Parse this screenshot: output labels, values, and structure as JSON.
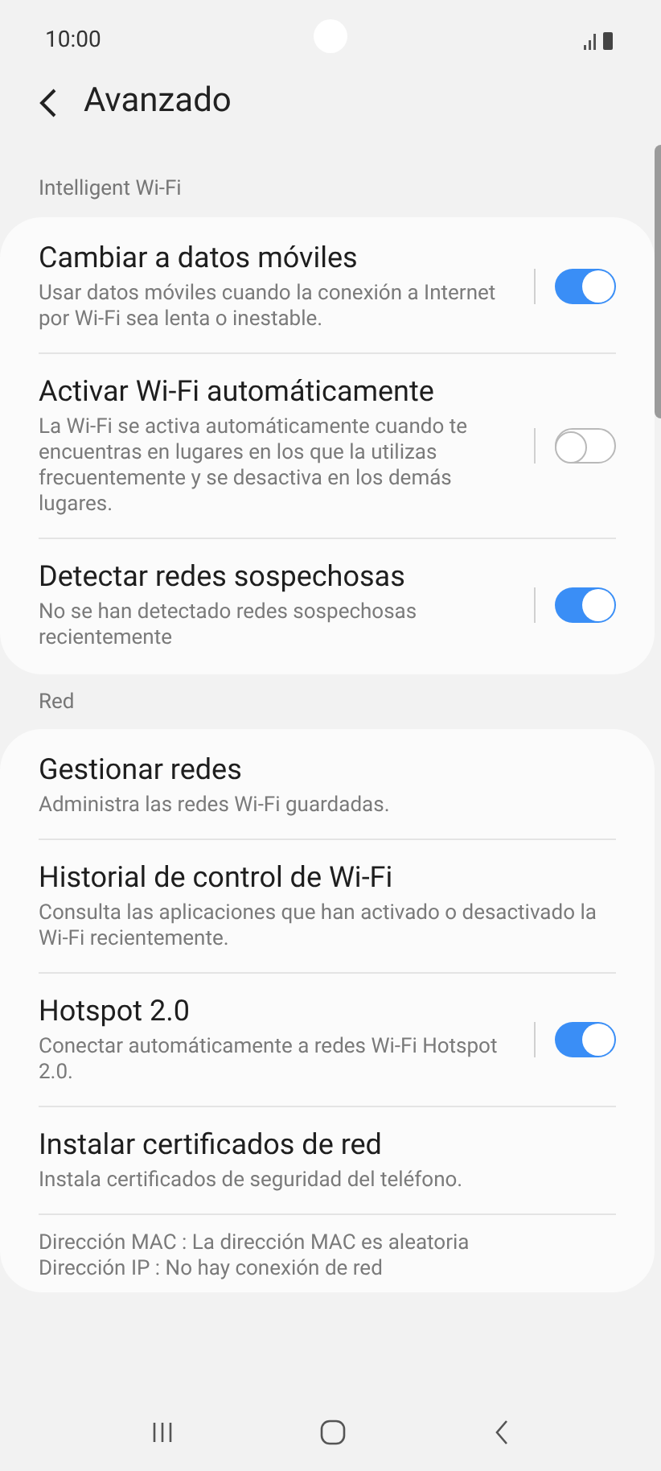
{
  "status_bar": {
    "time": "10:00"
  },
  "header": {
    "title": "Avanzado"
  },
  "sections": [
    {
      "label": "Intelligent Wi-Fi",
      "items": [
        {
          "kind": "toggle",
          "title": "Cambiar a datos móviles",
          "subtitle": "Usar datos móviles cuando la conexión a Internet por Wi-Fi sea lenta o inestable.",
          "on": true
        },
        {
          "kind": "toggle",
          "title": "Activar Wi-Fi automáticamente",
          "subtitle": "La Wi-Fi se activa automáticamente cuando te encuentras en lugares en los que la utilizas frecuentemente y se desactiva en los demás lugares.",
          "on": false
        },
        {
          "kind": "toggle",
          "title": "Detectar redes sospechosas",
          "subtitle": "No se han detectado redes sospechosas recientemente",
          "on": true
        }
      ]
    },
    {
      "label": "Red",
      "items": [
        {
          "kind": "link",
          "title": "Gestionar redes",
          "subtitle": "Administra las redes Wi-Fi guardadas."
        },
        {
          "kind": "link",
          "title": "Historial de control de Wi-Fi",
          "subtitle": "Consulta las aplicaciones que han activado o desactivado la Wi-Fi recientemente."
        },
        {
          "kind": "toggle",
          "title": "Hotspot 2.0",
          "subtitle": "Conectar automáticamente a redes Wi-Fi Hotspot 2.0.",
          "on": true
        },
        {
          "kind": "link",
          "title": "Instalar certificados de red",
          "subtitle": "Instala certificados de seguridad del teléfono."
        }
      ],
      "info": [
        "Dirección MAC : La dirección MAC es aleatoria",
        "Dirección IP : No hay conexión de red"
      ]
    }
  ]
}
